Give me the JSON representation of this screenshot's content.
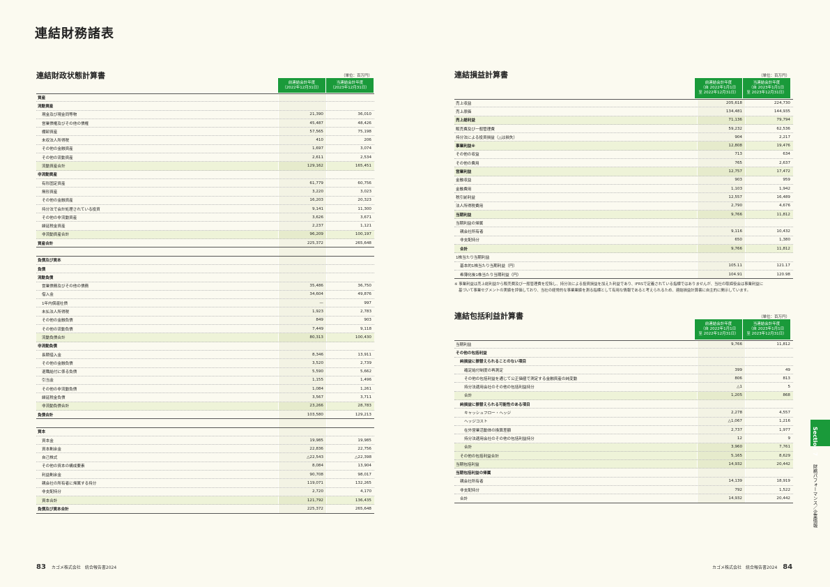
{
  "page_title": "連結財務諸表",
  "unit": "（単位：百万円）",
  "bs": {
    "title": "連結財政状態計算書",
    "col_prev": [
      "前連結会計年度",
      "（2022年12月31日）"
    ],
    "col_cur": [
      "当連結会計年度",
      "（2023年12月31日）"
    ],
    "rows": [
      {
        "label": "資産",
        "lv": 0,
        "bold": true
      },
      {
        "label": "流動資産",
        "lv": 0,
        "bold": true
      },
      {
        "label": "現金及び現金同等物",
        "lv": 1,
        "p": "21,390",
        "c": "36,010"
      },
      {
        "label": "営業債権及びその他の債権",
        "lv": 1,
        "p": "45,487",
        "c": "48,426"
      },
      {
        "label": "棚卸資産",
        "lv": 1,
        "p": "57,565",
        "c": "75,198"
      },
      {
        "label": "未収法人所得税",
        "lv": 1,
        "p": "410",
        "c": "206"
      },
      {
        "label": "その他の金融資産",
        "lv": 1,
        "p": "1,697",
        "c": "3,074"
      },
      {
        "label": "その他の流動資産",
        "lv": 1,
        "p": "2,611",
        "c": "2,534"
      },
      {
        "label": "流動資産合計",
        "lv": 1,
        "p": "129,162",
        "c": "165,451",
        "hl": true
      },
      {
        "label": "非流動資産",
        "lv": 0,
        "bold": true
      },
      {
        "label": "有形固定資産",
        "lv": 1,
        "p": "61,779",
        "c": "60,756"
      },
      {
        "label": "無形資産",
        "lv": 1,
        "p": "3,220",
        "c": "3,023"
      },
      {
        "label": "その他の金融資産",
        "lv": 1,
        "p": "16,203",
        "c": "20,323"
      },
      {
        "label": "持分法で会計処理されている投資",
        "lv": 1,
        "p": "9,141",
        "c": "11,300"
      },
      {
        "label": "その他の非流動資産",
        "lv": 1,
        "p": "3,626",
        "c": "3,671"
      },
      {
        "label": "繰延税金資産",
        "lv": 1,
        "p": "2,237",
        "c": "1,121"
      },
      {
        "label": "非流動資産合計",
        "lv": 1,
        "p": "96,209",
        "c": "100,197",
        "hl": true
      },
      {
        "label": "資産合計",
        "lv": 0,
        "bold": true,
        "p": "225,372",
        "c": "265,648",
        "solid": true
      },
      {
        "label": "",
        "lv": 0,
        "spacer": true
      },
      {
        "label": "負債及び資本",
        "lv": 0,
        "bold": true
      },
      {
        "label": "負債",
        "lv": 0,
        "bold": true
      },
      {
        "label": "流動負債",
        "lv": 0,
        "bold": true
      },
      {
        "label": "営業債務及びその他の債務",
        "lv": 1,
        "p": "35,486",
        "c": "36,750"
      },
      {
        "label": "借入金",
        "lv": 1,
        "p": "34,604",
        "c": "49,876"
      },
      {
        "label": "1年内償還社債",
        "lv": 1,
        "p": "—",
        "c": "997"
      },
      {
        "label": "未払法人所得税",
        "lv": 1,
        "p": "1,923",
        "c": "2,783"
      },
      {
        "label": "その他の金融負債",
        "lv": 1,
        "p": "849",
        "c": "903"
      },
      {
        "label": "その他の流動負債",
        "lv": 1,
        "p": "7,449",
        "c": "9,118"
      },
      {
        "label": "流動負債合計",
        "lv": 1,
        "p": "80,313",
        "c": "100,430",
        "hl": true
      },
      {
        "label": "非流動負債",
        "lv": 0,
        "bold": true
      },
      {
        "label": "長期借入金",
        "lv": 1,
        "p": "8,346",
        "c": "13,911"
      },
      {
        "label": "その他の金融負債",
        "lv": 1,
        "p": "3,520",
        "c": "2,739"
      },
      {
        "label": "退職給付に係る負債",
        "lv": 1,
        "p": "5,590",
        "c": "5,662"
      },
      {
        "label": "引当金",
        "lv": 1,
        "p": "1,155",
        "c": "1,496"
      },
      {
        "label": "その他の非流動負債",
        "lv": 1,
        "p": "1,084",
        "c": "1,261"
      },
      {
        "label": "繰延税金負債",
        "lv": 1,
        "p": "3,567",
        "c": "3,711"
      },
      {
        "label": "非流動負債合計",
        "lv": 1,
        "p": "23,266",
        "c": "28,783",
        "hl": true
      },
      {
        "label": "負債合計",
        "lv": 0,
        "bold": true,
        "p": "103,580",
        "c": "129,213",
        "solid": true
      },
      {
        "label": "",
        "lv": 0,
        "spacer": true
      },
      {
        "label": "資本",
        "lv": 0,
        "bold": true
      },
      {
        "label": "資本金",
        "lv": 1,
        "p": "19,985",
        "c": "19,985"
      },
      {
        "label": "資本剰余金",
        "lv": 1,
        "p": "22,836",
        "c": "22,756"
      },
      {
        "label": "自己株式",
        "lv": 1,
        "p": "△22,543",
        "c": "△22,398"
      },
      {
        "label": "その他の資本の構成要素",
        "lv": 1,
        "p": "8,084",
        "c": "13,904"
      },
      {
        "label": "利益剰余金",
        "lv": 1,
        "p": "90,708",
        "c": "98,017"
      },
      {
        "label": "親会社の所有者に帰属する持分",
        "lv": 1,
        "p": "119,071",
        "c": "132,265"
      },
      {
        "label": "非支配持分",
        "lv": 1,
        "p": "2,720",
        "c": "4,170"
      },
      {
        "label": "資本合計",
        "lv": 1,
        "p": "121,792",
        "c": "136,435",
        "hl": true
      },
      {
        "label": "負債及び資本合計",
        "lv": 0,
        "bold": true,
        "p": "225,372",
        "c": "265,648",
        "solid": true
      }
    ]
  },
  "pl": {
    "title": "連結損益計算書",
    "col_prev": [
      "前連結会計年度",
      "（自 2022年1月1日",
      "至 2022年12月31日）"
    ],
    "col_cur": [
      "当連結会計年度",
      "（自 2023年1月1日",
      "至 2023年12月31日）"
    ],
    "rows": [
      {
        "label": "売上収益",
        "lv": 0,
        "p": "205,618",
        "c": "224,730"
      },
      {
        "label": "売上原価",
        "lv": 0,
        "p": "134,481",
        "c": "144,935"
      },
      {
        "label": "売上総利益",
        "lv": 0,
        "bold": true,
        "p": "71,136",
        "c": "79,794",
        "hl": true
      },
      {
        "label": "販売費及び一般管理費",
        "lv": 0,
        "p": "59,232",
        "c": "62,536"
      },
      {
        "label": "持分法による投資損益（△は損失）",
        "lv": 0,
        "p": "904",
        "c": "2,217"
      },
      {
        "label": "事業利益※",
        "lv": 0,
        "bold": true,
        "p": "12,808",
        "c": "19,476",
        "hl": true
      },
      {
        "label": "その他の収益",
        "lv": 0,
        "p": "713",
        "c": "634"
      },
      {
        "label": "その他の費用",
        "lv": 0,
        "p": "765",
        "c": "2,637"
      },
      {
        "label": "営業利益",
        "lv": 0,
        "bold": true,
        "p": "12,757",
        "c": "17,472",
        "hl": true
      },
      {
        "label": "金融収益",
        "lv": 0,
        "p": "903",
        "c": "959"
      },
      {
        "label": "金融費用",
        "lv": 0,
        "p": "1,103",
        "c": "1,942"
      },
      {
        "label": "税引前利益",
        "lv": 0,
        "p": "12,557",
        "c": "16,489"
      },
      {
        "label": "法人所得税費用",
        "lv": 0,
        "p": "2,790",
        "c": "4,676"
      },
      {
        "label": "当期利益",
        "lv": 0,
        "bold": true,
        "p": "9,766",
        "c": "11,812",
        "hl": true
      },
      {
        "label": "当期利益の帰属",
        "lv": 0
      },
      {
        "label": "親会社所有者",
        "lv": 1,
        "p": "9,116",
        "c": "10,432"
      },
      {
        "label": "非支配持分",
        "lv": 1,
        "p": "650",
        "c": "1,380"
      },
      {
        "label": "合計",
        "lv": 1,
        "bold": true,
        "p": "9,766",
        "c": "11,812",
        "hl": true
      },
      {
        "label": "1株当たり当期利益",
        "lv": 0
      },
      {
        "label": "基本的1株当たり当期利益（円）",
        "lv": 1,
        "p": "105.11",
        "c": "121.17"
      },
      {
        "label": "希薄化後1株当たり当期利益（円）",
        "lv": 1,
        "p": "104.91",
        "c": "120.98",
        "solid": true
      }
    ],
    "note_line1": "※ 事業利益は売上総利益から販売費及び一般管理費を控除し、持分法による投資損益を加えた利益であり、IFRSで定義されている指標ではありませんが、当社の取締役会は事業利益に",
    "note_line2": "基づいて事業セグメントの実績を評価しており、当社の経常的な事業業績を測る指標として有用な情報であると考えられるため、連結損益計算書に自主的に開示しています。"
  },
  "ci": {
    "title": "連結包括利益計算書",
    "col_prev": [
      "前連結会計年度",
      "（自 2022年1月1日",
      "至 2022年12月31日）"
    ],
    "col_cur": [
      "当連結会計年度",
      "（自 2023年1月1日",
      "至 2023年12月31日）"
    ],
    "rows": [
      {
        "label": "当期利益",
        "lv": 0,
        "p": "9,766",
        "c": "11,812"
      },
      {
        "label": "その他の包括利益",
        "lv": 0,
        "bold": true
      },
      {
        "label": "純損益に振替えられることのない項目",
        "lv": 1,
        "bold": true
      },
      {
        "label": "確定給付制度の再測定",
        "lv": 2,
        "p": "399",
        "c": "49"
      },
      {
        "label": "その他の包括利益を通じて公正価値で測定する金融資産の純変動",
        "lv": 2,
        "p": "806",
        "c": "813"
      },
      {
        "label": "持分法適用会社のその他の包括利益持分",
        "lv": 2,
        "p": "△1",
        "c": "5"
      },
      {
        "label": "合計",
        "lv": 2,
        "p": "1,205",
        "c": "868",
        "hl": true
      },
      {
        "label": "純損益に振替えられる可能性のある項目",
        "lv": 1,
        "bold": true
      },
      {
        "label": "キャッシュフロー・ヘッジ",
        "lv": 2,
        "p": "2,278",
        "c": "4,557"
      },
      {
        "label": "ヘッジコスト",
        "lv": 2,
        "p": "△1,067",
        "c": "1,216"
      },
      {
        "label": "在外営業活動体の換算差額",
        "lv": 2,
        "p": "2,737",
        "c": "1,977"
      },
      {
        "label": "持分法適用会社のその他の包括利益持分",
        "lv": 2,
        "p": "12",
        "c": "9"
      },
      {
        "label": "合計",
        "lv": 2,
        "p": "3,960",
        "c": "7,761",
        "hl": true
      },
      {
        "label": "その他の包括利益合計",
        "lv": 1,
        "p": "5,165",
        "c": "8,629",
        "hl": true
      },
      {
        "label": "当期包括利益",
        "lv": 0,
        "p": "14,932",
        "c": "20,442",
        "hl": true
      },
      {
        "label": "当期包括利益の帰属",
        "lv": 0,
        "bold": true
      },
      {
        "label": "親会社所有者",
        "lv": 1,
        "p": "14,139",
        "c": "18,919"
      },
      {
        "label": "非支配持分",
        "lv": 1,
        "p": "792",
        "c": "1,522"
      },
      {
        "label": "合計",
        "lv": 1,
        "p": "14,932",
        "c": "20,442",
        "solid": true
      }
    ]
  },
  "footer_left": {
    "page": "83",
    "text": "カゴメ株式会社　統合報告書2024"
  },
  "footer_right": {
    "page": "84",
    "text": "カゴメ株式会社　統合報告書2024"
  },
  "sidebar": {
    "section": "Section 7",
    "subtitle": "財務パフォーマンス／企業情報"
  }
}
